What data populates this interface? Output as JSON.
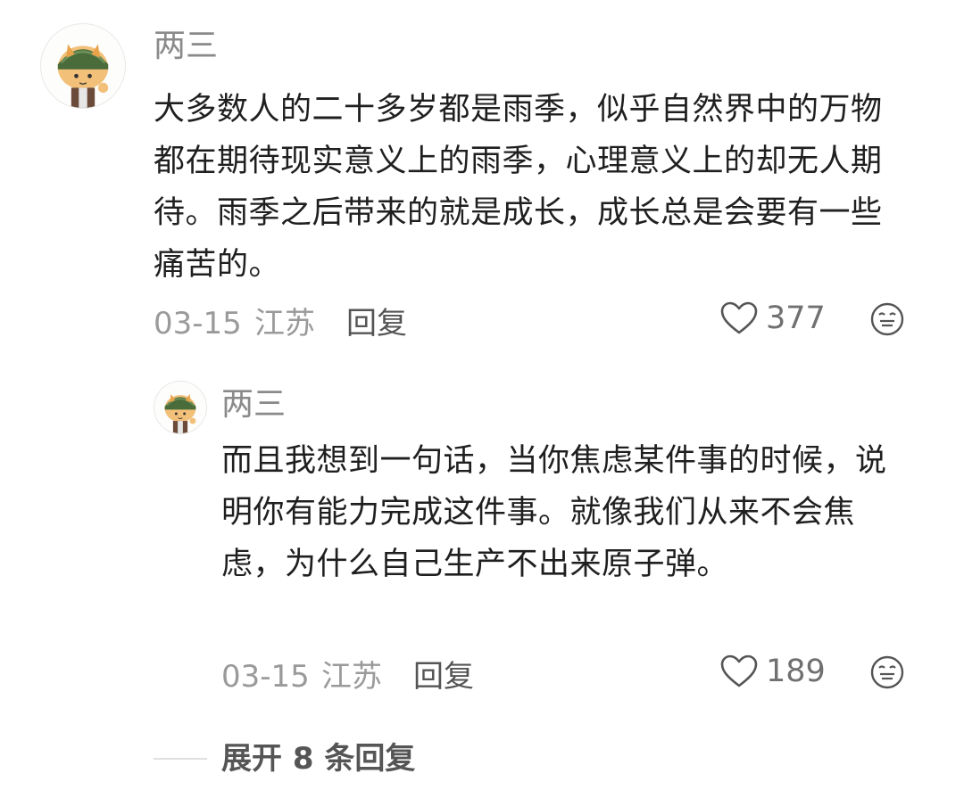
{
  "comment": {
    "username": "两三",
    "text": "大多数人的二十多岁都是雨季，似乎自然界中的万物都在期待现实意义上的雨季，心理意义上的却无人期待。雨季之后带来的就是成长，成长总是会要有一些痛苦的。",
    "date": "03-15",
    "location": "江苏",
    "reply_label": "回复",
    "likes": "377",
    "avatar_icon": "cartoon-avatar-icon",
    "like_icon": "heart-outline-icon",
    "emoji_icon": "smiley-face-icon"
  },
  "reply": {
    "username": "两三",
    "text": "而且我想到一句话，当你焦虑某件事的时候，说明你有能力完成这件事。就像我们从来不会焦虑，为什么自己生产不出来原子弹。",
    "date": "03-15",
    "location": "江苏",
    "reply_label": "回复",
    "likes": "189",
    "avatar_icon": "cartoon-avatar-icon",
    "like_icon": "heart-outline-icon",
    "emoji_icon": "smiley-face-icon"
  },
  "expand_replies_label": "展开 8 条回复",
  "colors": {
    "text_primary": "#1f1f1f",
    "text_secondary": "#9a9a9a",
    "hat_green": "#4a6b3a",
    "hair_orange": "#e8a24a"
  }
}
